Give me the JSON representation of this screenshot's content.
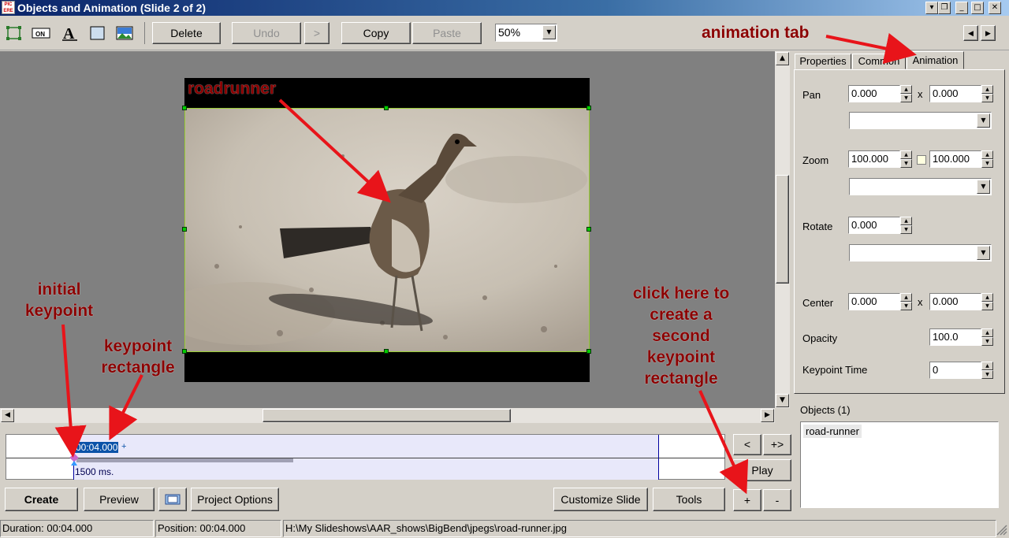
{
  "window": {
    "title": "Objects and Animation  (Slide 2 of 2)",
    "app_icon_text": "PIC ERE"
  },
  "toolbar": {
    "delete": "Delete",
    "undo": "Undo",
    "redo": ">",
    "copy": "Copy",
    "paste": "Paste",
    "zoom": "50%",
    "icons": [
      "select-rect-icon",
      "on-button-icon",
      "text-icon",
      "rectangle-icon",
      "image-icon"
    ]
  },
  "canvas": {
    "object_label": "roadrunner"
  },
  "tabs": [
    "Properties",
    "Common",
    "Animation"
  ],
  "animation": {
    "pan_label": "Pan",
    "pan_x": "0.000",
    "pan_y": "0.000",
    "x_sep": "x",
    "zoom_label": "Zoom",
    "zoom_x": "100.000",
    "zoom_y": "100.000",
    "rotate_label": "Rotate",
    "rotate": "0.000",
    "center_label": "Center",
    "center_x": "0.000",
    "center_y": "0.000",
    "opacity_label": "Opacity",
    "opacity": "100.0",
    "keypoint_time_label": "Keypoint Time",
    "keypoint_time": "0"
  },
  "objects": {
    "header": "Objects (1)",
    "items": [
      "road-runner"
    ]
  },
  "timeline": {
    "keypoint_time": "00:04.000",
    "plus": "+",
    "duration_label": "1500 ms."
  },
  "timeline_buttons": {
    "prev": "<",
    "add_next": "+>",
    "play": "Play",
    "add": "+",
    "remove": "-"
  },
  "bottom": {
    "create": "Create",
    "preview": "Preview",
    "project_options": "Project Options",
    "customize_slide": "Customize Slide",
    "tools": "Tools"
  },
  "status": {
    "duration": "Duration:  00:04.000",
    "position": "Position:  00:04.000",
    "path": "H:\\My Slideshows\\AAR_shows\\BigBend\\jpegs\\road-runner.jpg"
  },
  "annotations": {
    "animation_tab": "animation tab",
    "initial_keypoint": "initial keypoint",
    "keypoint_rectangle": "keypoint rectangle",
    "click_here": "click here to create a second keypoint rectangle"
  },
  "colors": {
    "annotation": "#8b0000",
    "arrow": "#e8141a",
    "title_bar": "#0a246a",
    "timeline_fill": "#e8e8fa",
    "keypoint_highlight": "#0a52a8"
  }
}
